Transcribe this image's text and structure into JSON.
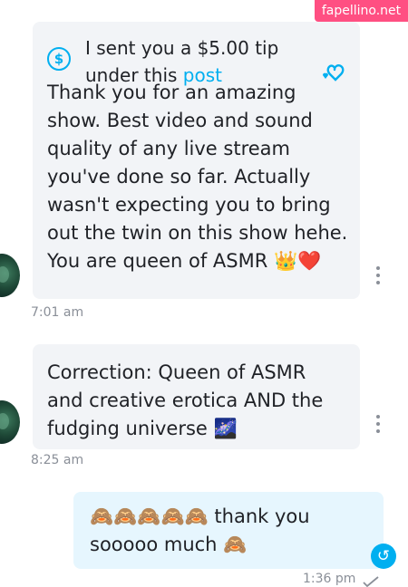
{
  "watermark": "fapellino.net",
  "messages": {
    "tip": {
      "line1": "I sent you a $5.00 tip",
      "line2_prefix": "under this ",
      "link": "post",
      "icon": "dollar-circle-icon",
      "reaction_icon": "heart-outline-icon"
    },
    "first": {
      "lines": [
        "Thank you for an amazing",
        "show. Best video and sound",
        "quality of any live stream",
        "you've done so far. Actually",
        "wasn't expecting you to bring",
        "out the twin on this show hehe.",
        "You are queen of ASMR"
      ],
      "emojis": "👑❤️",
      "time": "7:01 am"
    },
    "second": {
      "lines": [
        "Correction: Queen of ASMR",
        "and creative erotica AND the",
        "fudging universe"
      ],
      "emoji": "🌌",
      "time": "8:25 am"
    },
    "reply": {
      "line1_emojis": "🙈🙈🙈🙈🙈",
      "line1_text": " thank you",
      "line2_text": "sooooo much ",
      "line2_emoji": "🙈",
      "time": "1:36 pm",
      "status_icon": "check-icon",
      "undo_icon": "undo-icon"
    }
  },
  "colors": {
    "accent": "#00aff0",
    "incoming_bubble": "#f2f4f7",
    "outgoing_bubble": "#e6f6fe",
    "watermark": "#ff4f82"
  }
}
